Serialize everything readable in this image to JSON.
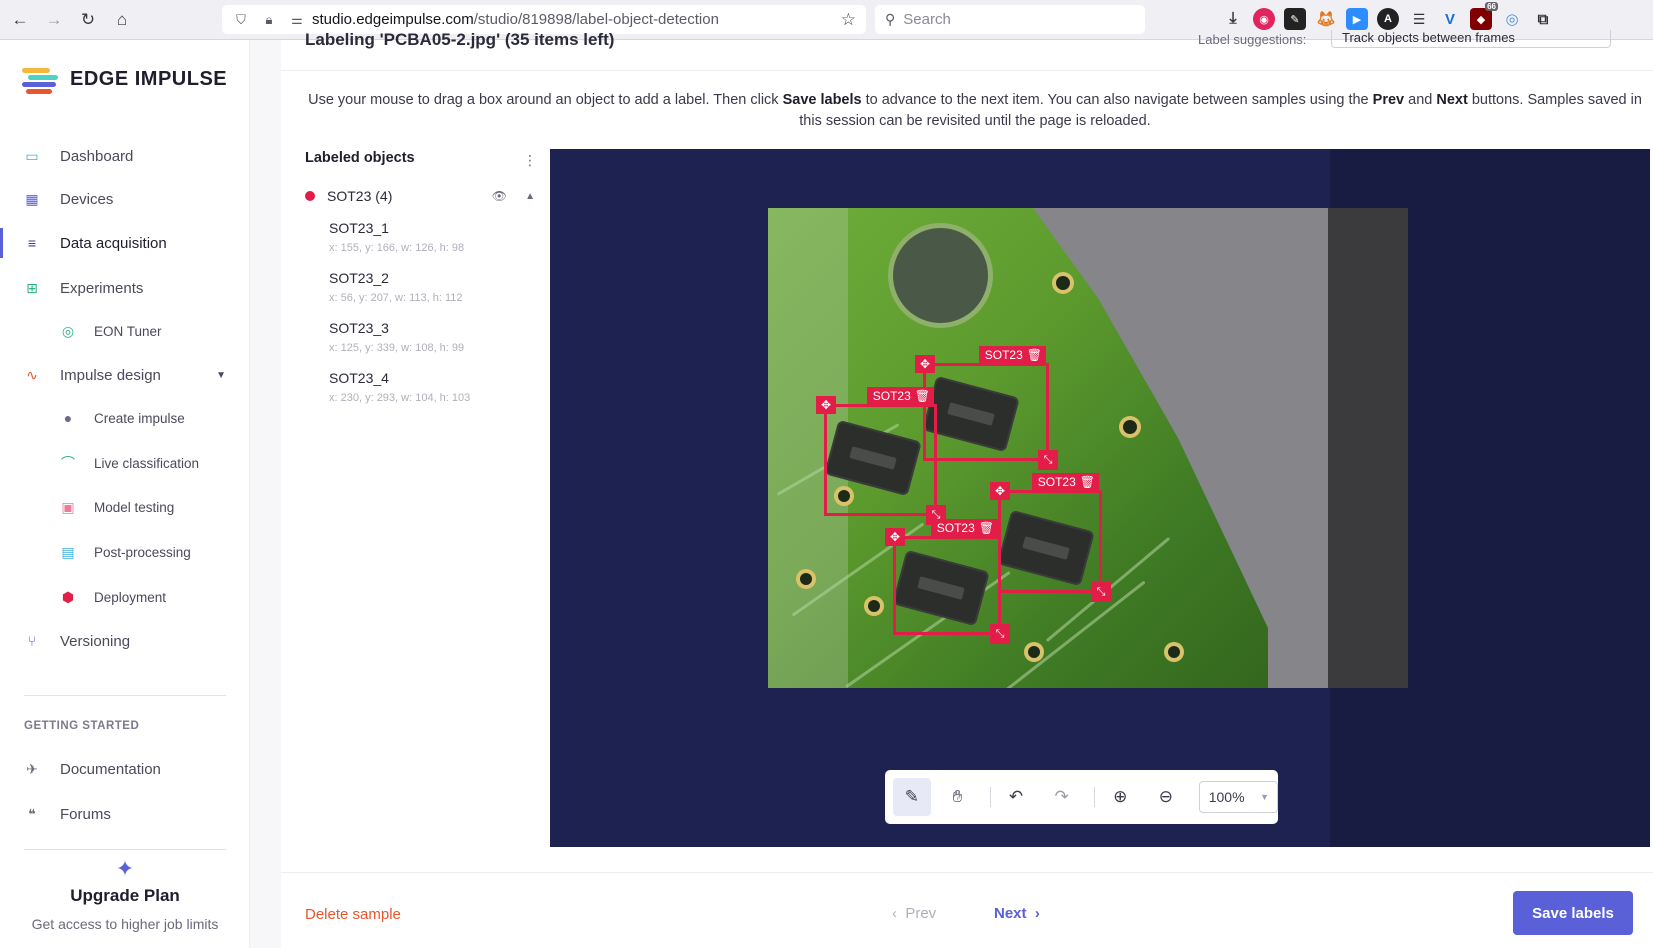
{
  "browser": {
    "url_host": "studio.edgeimpulse.com",
    "url_path": "/studio/819898/label-object-detection",
    "search_placeholder": "Search",
    "badge": "66"
  },
  "sidebar": {
    "brand": "EDGE IMPULSE",
    "items": [
      {
        "label": "Dashboard",
        "icon": "monitor-icon"
      },
      {
        "label": "Devices",
        "icon": "chip-icon"
      },
      {
        "label": "Data acquisition",
        "icon": "database-icon",
        "active": true
      },
      {
        "label": "Experiments",
        "icon": "grid-icon"
      },
      {
        "label": "EON Tuner",
        "icon": "tuner-icon"
      },
      {
        "label": "Impulse design",
        "icon": "pulse-icon"
      },
      {
        "label": "Create impulse",
        "icon": "dot-icon"
      },
      {
        "label": "Live classification",
        "icon": "radar-icon"
      },
      {
        "label": "Model testing",
        "icon": "clipboard-icon"
      },
      {
        "label": "Post-processing",
        "icon": "doc-icon"
      },
      {
        "label": "Deployment",
        "icon": "cube-icon"
      },
      {
        "label": "Versioning",
        "icon": "branch-icon"
      }
    ],
    "section_getting_started": "GETTING STARTED",
    "documentation": "Documentation",
    "forums": "Forums",
    "upgrade_title": "Upgrade Plan",
    "upgrade_desc": "Get access to higher job limits"
  },
  "header": {
    "title_cut": "Labeling 'PCBA05-2.jpg' (35 items left)",
    "label_suggestions": "Label suggestions:",
    "label_suggestions_value": "Track objects between frames"
  },
  "instructions": {
    "p1": "Use your mouse to drag a box around an object to add a label. Then click ",
    "b1": "Save labels",
    "p2": " to advance to the next item. You can also navigate between samples using the ",
    "b2": "Prev",
    "p3": " and ",
    "b3": "Next",
    "p4": " buttons. Samples saved in this session can be revisited until the page is reloaded."
  },
  "labeled_objects": {
    "title": "Labeled objects",
    "class_label": "SOT23 (4)",
    "class_color": "#e11d48",
    "objects": [
      {
        "name": "SOT23_1",
        "coords": "x: 155, y: 166, w: 126, h: 98"
      },
      {
        "name": "SOT23_2",
        "coords": "x: 56, y: 207, w: 113, h: 112"
      },
      {
        "name": "SOT23_3",
        "coords": "x: 125, y: 339, w: 108, h: 99"
      },
      {
        "name": "SOT23_4",
        "coords": "x: 230, y: 293, w: 104, h: 103"
      }
    ]
  },
  "canvas": {
    "box_label": "SOT23",
    "zoom": "100%"
  },
  "footer": {
    "delete": "Delete sample",
    "prev": "Prev",
    "next": "Next",
    "save": "Save labels"
  },
  "colors": {
    "accent": "#5a60d8",
    "label": "#e11d48",
    "danger": "#e8552f"
  }
}
